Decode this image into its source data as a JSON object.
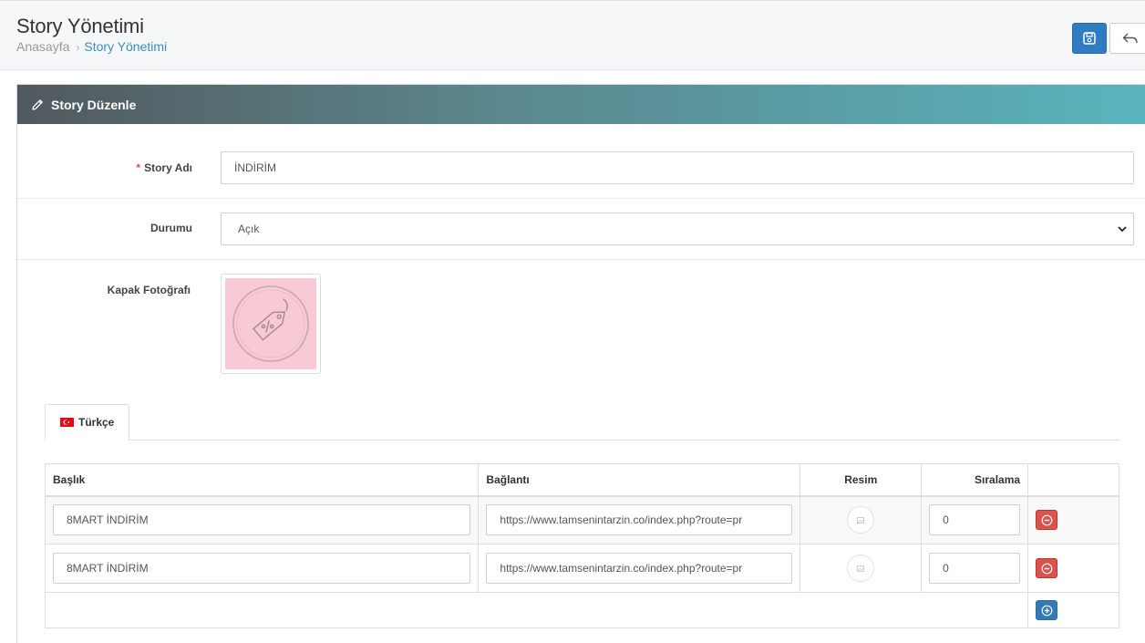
{
  "header": {
    "title": "Story Yönetimi",
    "breadcrumb": {
      "home": "Anasayfa",
      "separator": "›",
      "current": "Story Yönetimi"
    }
  },
  "actions": {
    "save_icon": "floppy-disk-icon",
    "back_icon": "reply-arrow-icon"
  },
  "panel": {
    "title": "Story Düzenle",
    "title_icon": "pencil-icon"
  },
  "form": {
    "story_name": {
      "required_mark": "*",
      "label": "Story Adı",
      "value": "İNDİRİM"
    },
    "status": {
      "label": "Durumu",
      "selected": "Açık"
    },
    "cover": {
      "label": "Kapak Fotoğrafı"
    }
  },
  "tabs": [
    {
      "label": "Türkçe",
      "active": true
    }
  ],
  "table": {
    "headers": {
      "title": "Başlık",
      "link": "Bağlantı",
      "image": "Resim",
      "order": "Sıralama"
    },
    "rows": [
      {
        "title": "8MART İNDİRİM",
        "link": "https://www.tamsenintarzin.co/index.php?route=pr",
        "order": "0"
      },
      {
        "title": "8MART İNDİRİM",
        "link": "https://www.tamsenintarzin.co/index.php?route=pr",
        "order": "0"
      }
    ]
  },
  "colors": {
    "primary": "#2f7cc1",
    "danger": "#d9534f",
    "accent_link": "#3c8dbc",
    "cover_bg": "#f8cad5"
  }
}
